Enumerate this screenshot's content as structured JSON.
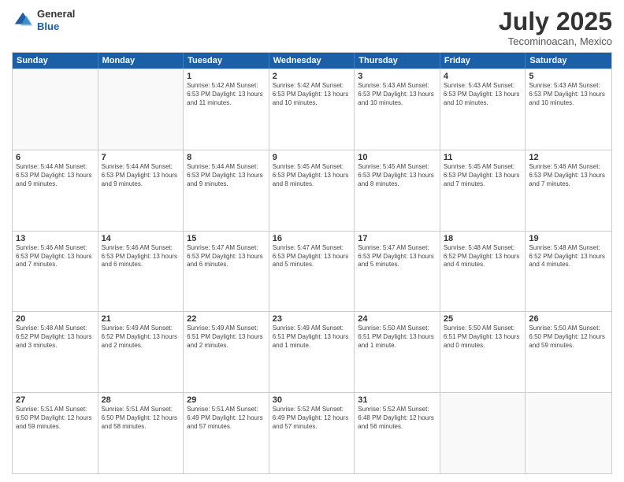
{
  "header": {
    "logo_line1": "General",
    "logo_line2": "Blue",
    "month": "July 2025",
    "location": "Tecominoacan, Mexico"
  },
  "days_of_week": [
    "Sunday",
    "Monday",
    "Tuesday",
    "Wednesday",
    "Thursday",
    "Friday",
    "Saturday"
  ],
  "weeks": [
    [
      {
        "day": "",
        "info": ""
      },
      {
        "day": "",
        "info": ""
      },
      {
        "day": "1",
        "info": "Sunrise: 5:42 AM\nSunset: 6:53 PM\nDaylight: 13 hours and 11 minutes."
      },
      {
        "day": "2",
        "info": "Sunrise: 5:42 AM\nSunset: 6:53 PM\nDaylight: 13 hours and 10 minutes."
      },
      {
        "day": "3",
        "info": "Sunrise: 5:43 AM\nSunset: 6:53 PM\nDaylight: 13 hours and 10 minutes."
      },
      {
        "day": "4",
        "info": "Sunrise: 5:43 AM\nSunset: 6:53 PM\nDaylight: 13 hours and 10 minutes."
      },
      {
        "day": "5",
        "info": "Sunrise: 5:43 AM\nSunset: 6:53 PM\nDaylight: 13 hours and 10 minutes."
      }
    ],
    [
      {
        "day": "6",
        "info": "Sunrise: 5:44 AM\nSunset: 6:53 PM\nDaylight: 13 hours and 9 minutes."
      },
      {
        "day": "7",
        "info": "Sunrise: 5:44 AM\nSunset: 6:53 PM\nDaylight: 13 hours and 9 minutes."
      },
      {
        "day": "8",
        "info": "Sunrise: 5:44 AM\nSunset: 6:53 PM\nDaylight: 13 hours and 9 minutes."
      },
      {
        "day": "9",
        "info": "Sunrise: 5:45 AM\nSunset: 6:53 PM\nDaylight: 13 hours and 8 minutes."
      },
      {
        "day": "10",
        "info": "Sunrise: 5:45 AM\nSunset: 6:53 PM\nDaylight: 13 hours and 8 minutes."
      },
      {
        "day": "11",
        "info": "Sunrise: 5:45 AM\nSunset: 6:53 PM\nDaylight: 13 hours and 7 minutes."
      },
      {
        "day": "12",
        "info": "Sunrise: 5:46 AM\nSunset: 6:53 PM\nDaylight: 13 hours and 7 minutes."
      }
    ],
    [
      {
        "day": "13",
        "info": "Sunrise: 5:46 AM\nSunset: 6:53 PM\nDaylight: 13 hours and 7 minutes."
      },
      {
        "day": "14",
        "info": "Sunrise: 5:46 AM\nSunset: 6:53 PM\nDaylight: 13 hours and 6 minutes."
      },
      {
        "day": "15",
        "info": "Sunrise: 5:47 AM\nSunset: 6:53 PM\nDaylight: 13 hours and 6 minutes."
      },
      {
        "day": "16",
        "info": "Sunrise: 5:47 AM\nSunset: 6:53 PM\nDaylight: 13 hours and 5 minutes."
      },
      {
        "day": "17",
        "info": "Sunrise: 5:47 AM\nSunset: 6:53 PM\nDaylight: 13 hours and 5 minutes."
      },
      {
        "day": "18",
        "info": "Sunrise: 5:48 AM\nSunset: 6:52 PM\nDaylight: 13 hours and 4 minutes."
      },
      {
        "day": "19",
        "info": "Sunrise: 5:48 AM\nSunset: 6:52 PM\nDaylight: 13 hours and 4 minutes."
      }
    ],
    [
      {
        "day": "20",
        "info": "Sunrise: 5:48 AM\nSunset: 6:52 PM\nDaylight: 13 hours and 3 minutes."
      },
      {
        "day": "21",
        "info": "Sunrise: 5:49 AM\nSunset: 6:52 PM\nDaylight: 13 hours and 2 minutes."
      },
      {
        "day": "22",
        "info": "Sunrise: 5:49 AM\nSunset: 6:51 PM\nDaylight: 13 hours and 2 minutes."
      },
      {
        "day": "23",
        "info": "Sunrise: 5:49 AM\nSunset: 6:51 PM\nDaylight: 13 hours and 1 minute."
      },
      {
        "day": "24",
        "info": "Sunrise: 5:50 AM\nSunset: 6:51 PM\nDaylight: 13 hours and 1 minute."
      },
      {
        "day": "25",
        "info": "Sunrise: 5:50 AM\nSunset: 6:51 PM\nDaylight: 13 hours and 0 minutes."
      },
      {
        "day": "26",
        "info": "Sunrise: 5:50 AM\nSunset: 6:50 PM\nDaylight: 12 hours and 59 minutes."
      }
    ],
    [
      {
        "day": "27",
        "info": "Sunrise: 5:51 AM\nSunset: 6:50 PM\nDaylight: 12 hours and 59 minutes."
      },
      {
        "day": "28",
        "info": "Sunrise: 5:51 AM\nSunset: 6:50 PM\nDaylight: 12 hours and 58 minutes."
      },
      {
        "day": "29",
        "info": "Sunrise: 5:51 AM\nSunset: 6:49 PM\nDaylight: 12 hours and 57 minutes."
      },
      {
        "day": "30",
        "info": "Sunrise: 5:52 AM\nSunset: 6:49 PM\nDaylight: 12 hours and 57 minutes."
      },
      {
        "day": "31",
        "info": "Sunrise: 5:52 AM\nSunset: 6:48 PM\nDaylight: 12 hours and 56 minutes."
      },
      {
        "day": "",
        "info": ""
      },
      {
        "day": "",
        "info": ""
      }
    ]
  ]
}
